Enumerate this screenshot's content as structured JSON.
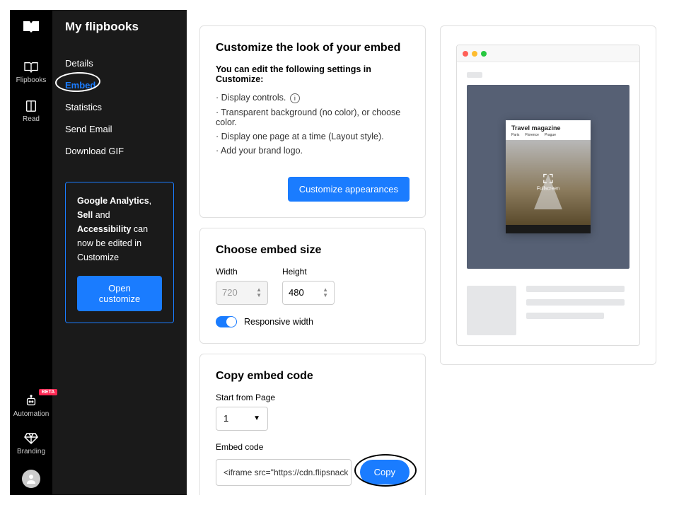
{
  "rail": {
    "items": [
      "Flipbooks",
      "Read"
    ],
    "bottom": [
      "Automation",
      "Branding"
    ],
    "beta": "BETA"
  },
  "sidebar": {
    "title": "My flipbooks",
    "items": [
      "Details",
      "Embed",
      "Statistics",
      "Send Email",
      "Download GIF"
    ],
    "info": {
      "b1": "Google Analytics",
      "t1": ", ",
      "b2": "Sell",
      "t2": " and ",
      "b3": "Accessibility",
      "t3": " can now be edited in Customize",
      "btn": "Open customize"
    }
  },
  "customize": {
    "title": "Customize the look of your embed",
    "sub": "You can edit the following settings in Customize:",
    "bullets": [
      "Display controls.",
      "Transparent background (no color), or choose color.",
      "Display one page at a time (Layout style).",
      "Add your brand logo."
    ],
    "btn": "Customize appearances"
  },
  "size": {
    "title": "Choose embed size",
    "width_label": "Width",
    "width_val": "720",
    "height_label": "Height",
    "height_val": "480",
    "toggle_label": "Responsive width"
  },
  "embed": {
    "title": "Copy embed code",
    "page_label": "Start from Page",
    "page_val": "1",
    "code_label": "Embed code",
    "code_val": "<iframe src=\"https://cdn.flipsnack",
    "copy": "Copy"
  },
  "preview": {
    "mag_title": "Travel magazine",
    "cities": [
      "Paris",
      "Florence",
      "Prague"
    ],
    "fullscreen": "Fullscreen"
  }
}
